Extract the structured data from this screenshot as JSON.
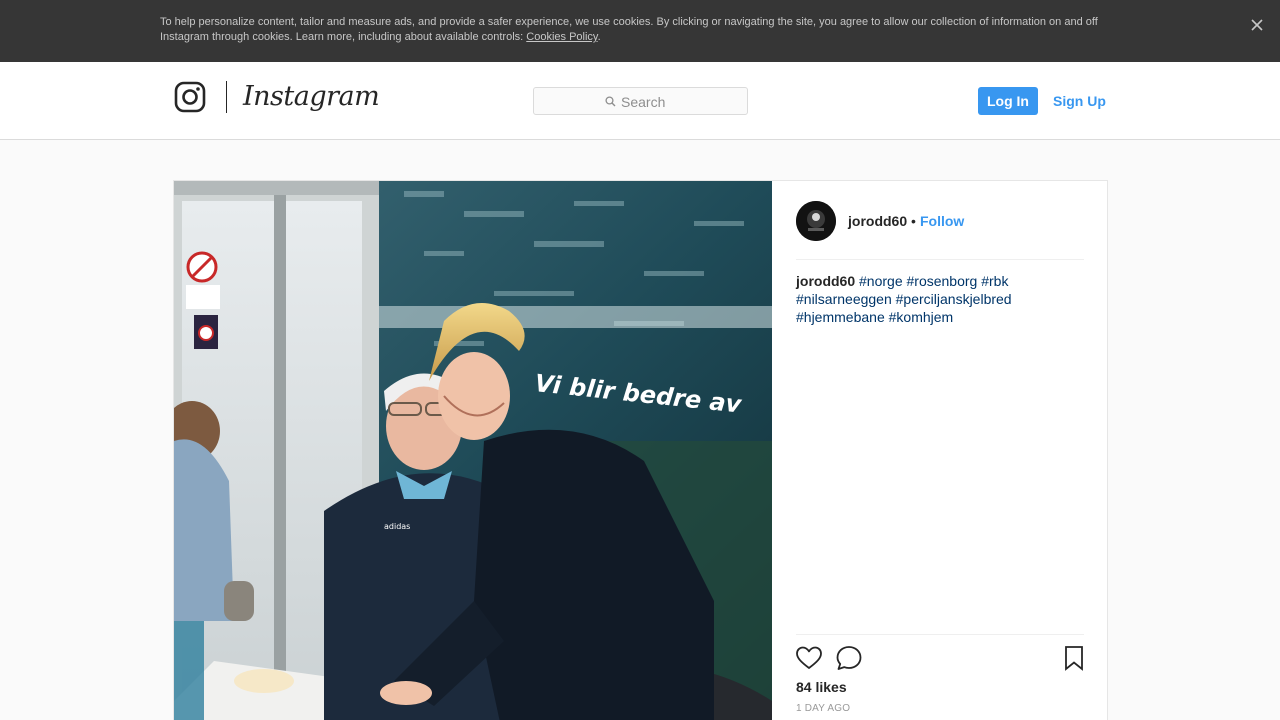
{
  "cookie_banner": {
    "text": "To help personalize content, tailor and measure ads, and provide a safer experience, we use cookies. By clicking or navigating the site, you agree to allow our collection of information on and off Instagram through cookies. Learn more, including about available controls: ",
    "link_label": "Cookies Policy",
    "text_end": ".",
    "close_icon": "close-icon"
  },
  "header": {
    "logo_glyph_icon": "instagram-glyph-icon",
    "wordmark": "Instagram",
    "search_placeholder": "Search",
    "search_icon": "search-icon",
    "login_label": "Log In",
    "signup_label": "Sign Up"
  },
  "post": {
    "username": "jorodd60",
    "separator": "•",
    "follow_label": "Follow",
    "caption": {
      "username": "jorodd60",
      "hashtags": [
        "#norge",
        "#rosenborg",
        "#rbk",
        "#nilsarneeggen",
        "#perciljanskjelbred",
        "#hjemmebane",
        "#komhjem"
      ]
    },
    "actions": {
      "like_icon": "heart-icon",
      "comment_icon": "comment-icon",
      "save_icon": "bookmark-icon"
    },
    "likes": "84 likes",
    "time": "1 DAY AGO"
  },
  "colors": {
    "accent": "#3897f0",
    "hashtag": "#003569",
    "banner": "#363636"
  }
}
